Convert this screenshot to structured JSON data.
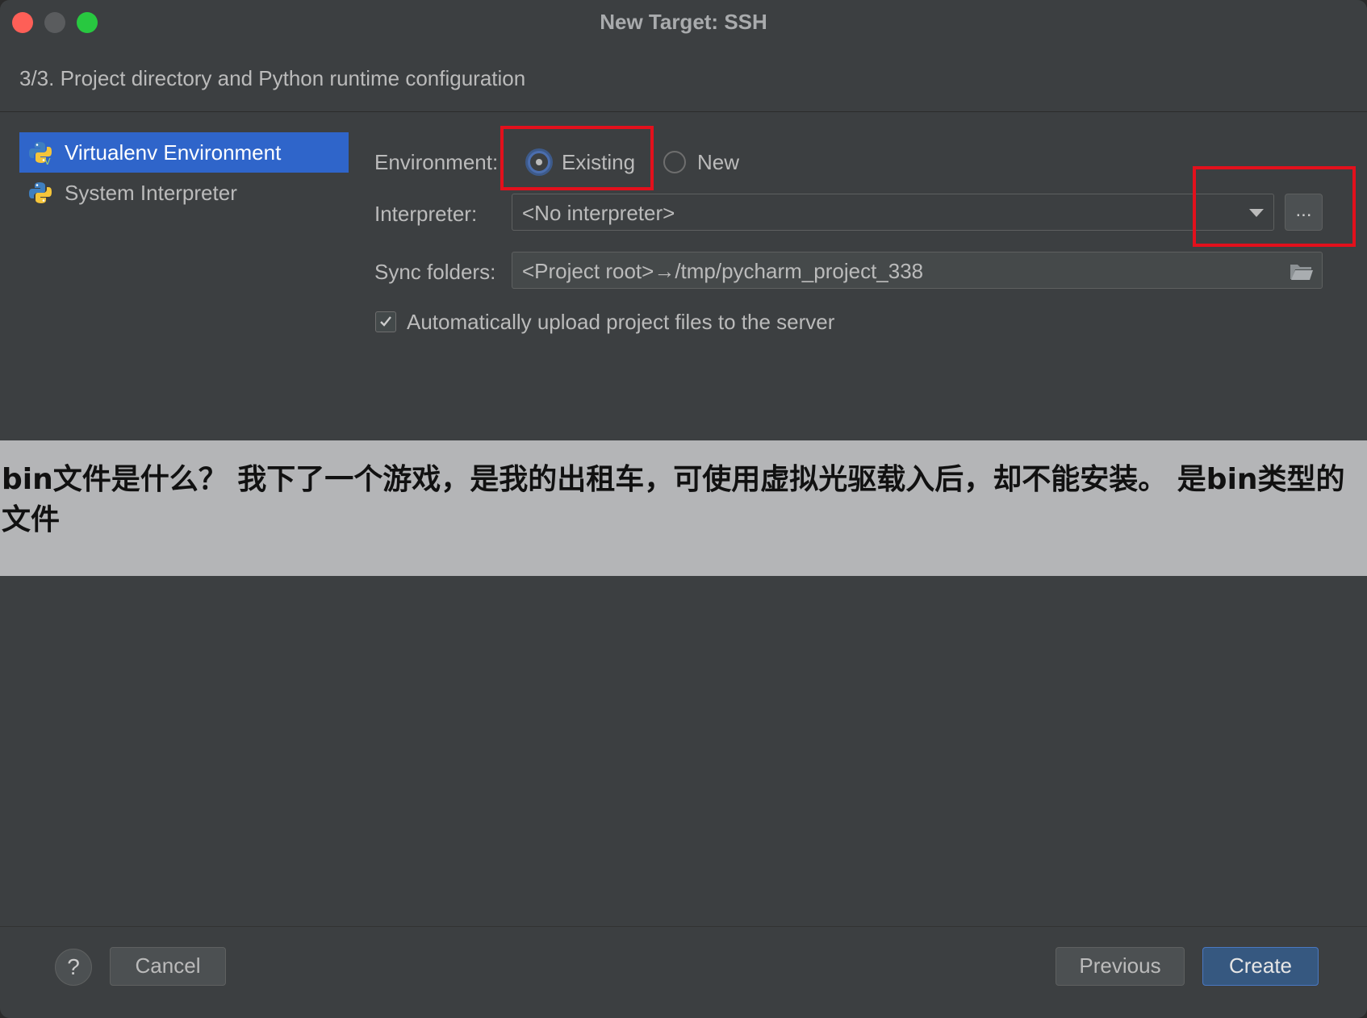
{
  "window": {
    "title": "New Target: SSH"
  },
  "step": {
    "header": "3/3. Project directory and Python runtime configuration"
  },
  "environments": [
    {
      "label": "Virtualenv Environment",
      "selected": true
    },
    {
      "label": "System Interpreter",
      "selected": false
    }
  ],
  "form": {
    "environment_label": "Environment:",
    "radio_existing": "Existing",
    "radio_new": "New",
    "selected_radio": "Existing",
    "interpreter_label": "Interpreter:",
    "interpreter_value": "<No interpreter>",
    "browse_label": "...",
    "sync_label": "Sync folders:",
    "sync_value": "<Project root>→/tmp/pycharm_project_338",
    "auto_upload_label": "Automatically upload project files to the server",
    "auto_upload_checked": true
  },
  "overlay": {
    "line1": "bin文件是什么？  我下了一个游戏，是我的出租车，可使用虚拟光驱载入后，却不能安装。 是bin类型的",
    "line2": "文件"
  },
  "footer": {
    "help_label": "?",
    "cancel_label": "Cancel",
    "previous_label": "Previous",
    "create_label": "Create"
  },
  "colors": {
    "background": "#3c3f41",
    "selection": "#2f65ca",
    "primary_button": "#365880",
    "highlight_box": "#e3101c",
    "overlay_banner": "#b4b5b7"
  }
}
